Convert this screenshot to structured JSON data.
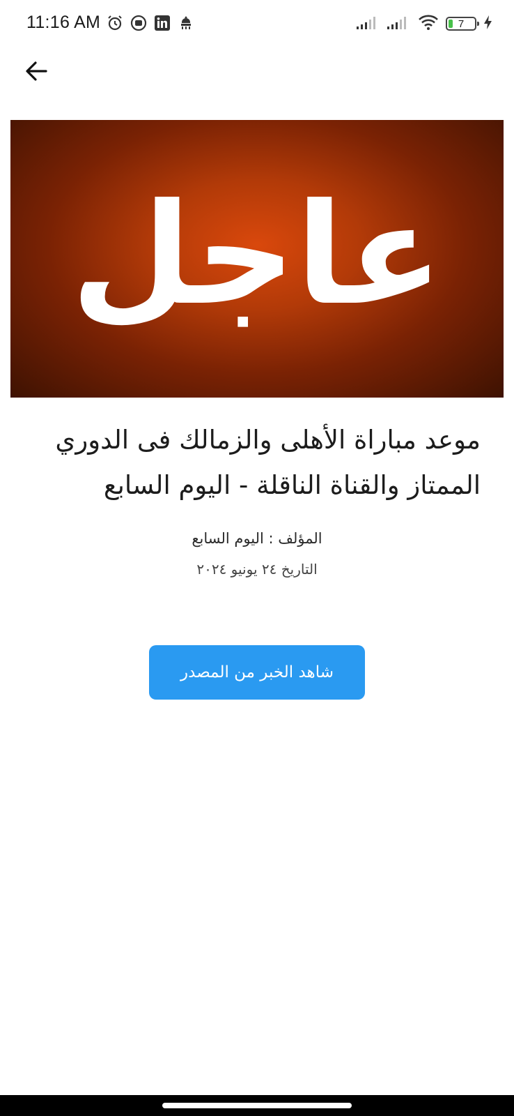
{
  "status_bar": {
    "time": "11:16 AM",
    "left_icons": [
      "alarm-icon",
      "screen-record-icon",
      "linkedin-icon",
      "app-notification-icon"
    ],
    "right_icons": [
      "signal-icon",
      "signal-icon",
      "wifi-icon"
    ],
    "battery_level": "7"
  },
  "app_bar": {
    "back_icon": "arrow-left-icon"
  },
  "hero": {
    "text": "عاجل"
  },
  "article": {
    "title": "موعد مباراة الأهلى والزمالك فى الدوري الممتاز والقناة الناقلة - اليوم السابع",
    "author_line": "المؤلف : اليوم السابع",
    "date_line": "التاريخ  ٢٤ يونيو ٢٠٢٤"
  },
  "actions": {
    "source_button_label": "شاهد الخبر من المصدر"
  },
  "colors": {
    "button": "#2a9af1",
    "hero_center": "#d9480c",
    "hero_edge": "#3e1202",
    "battery_fill": "#48c04a"
  }
}
